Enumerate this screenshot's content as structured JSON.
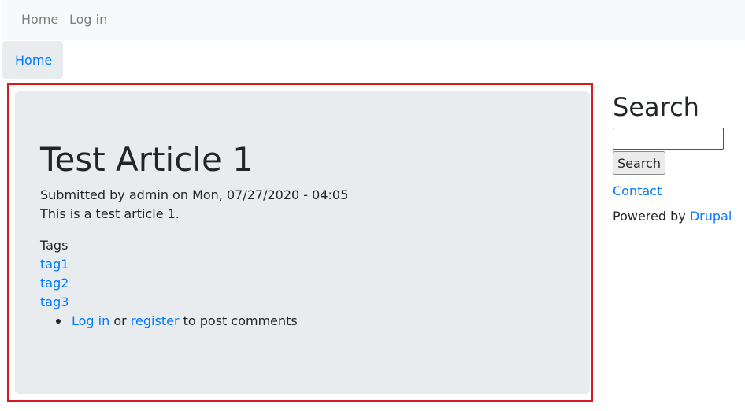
{
  "topnav": {
    "home": "Home",
    "login": "Log in"
  },
  "breadcrumb": {
    "home": "Home"
  },
  "article": {
    "title": "Test Article 1",
    "meta": "Submitted by admin on Mon, 07/27/2020 - 04:05",
    "body": "This is a test article 1.",
    "tags_label": "Tags",
    "tags": [
      "tag1",
      "tag2",
      "tag3"
    ],
    "comment": {
      "login": "Log in",
      "or": "or",
      "register": "register",
      "suffix": "to post comments"
    }
  },
  "sidebar": {
    "search_title": "Search",
    "search_value": "",
    "search_button": "Search",
    "contact": "Contact",
    "powered_prefix": "Powered by",
    "powered_link": "Drupal"
  },
  "colors": {
    "link": "#007bff",
    "highlight_border": "#d71920",
    "panel": "#e9ecef"
  }
}
